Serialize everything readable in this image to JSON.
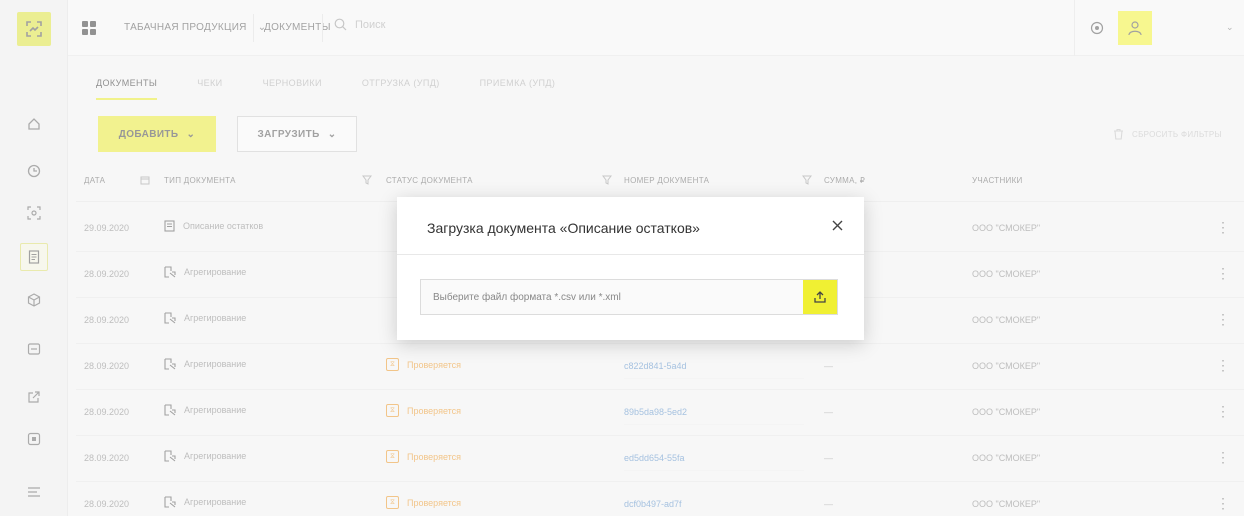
{
  "topbar": {
    "product": "ТАБАЧНАЯ ПРОДУКЦИЯ",
    "documents": "ДОКУМЕНТЫ",
    "search_placeholder": "Поиск"
  },
  "tabs": [
    {
      "label": "ДОКУМЕНТЫ",
      "active": true
    },
    {
      "label": "ЧЕКИ"
    },
    {
      "label": "ЧЕРНОВИКИ"
    },
    {
      "label": "ОТГРУЗКА (УПД)"
    },
    {
      "label": "ПРИЕМКА (УПД)"
    }
  ],
  "actions": {
    "add": "ДОБАВИТЬ",
    "load": "ЗАГРУЗИТЬ",
    "reset_filters": "СБРОСИТЬ ФИЛЬТРЫ"
  },
  "table": {
    "headers": {
      "date": "ДАТА",
      "type": "ТИП ДОКУМЕНТА",
      "status": "СТАТУС ДОКУМЕНТА",
      "number": "НОМЕР ДОКУМЕНТА",
      "sum": "СУММА, ₽",
      "participants": "УЧАСТНИКИ"
    },
    "rows": [
      {
        "date": "29.09.2020",
        "type": "Описание остатков",
        "status": "",
        "number": "",
        "sum": "",
        "participants": "ООО \"СМОКЕР\""
      },
      {
        "date": "28.09.2020",
        "type": "Агрегирование",
        "status": "",
        "number": "",
        "sum": "",
        "participants": "ООО \"СМОКЕР\""
      },
      {
        "date": "28.09.2020",
        "type": "Агрегирование",
        "status": "",
        "number": "",
        "sum": "",
        "participants": "ООО \"СМОКЕР\""
      },
      {
        "date": "28.09.2020",
        "type": "Агрегирование",
        "status": "Проверяется",
        "number": "c822d841-5a4d",
        "sum": "—",
        "participants": "ООО \"СМОКЕР\""
      },
      {
        "date": "28.09.2020",
        "type": "Агрегирование",
        "status": "Проверяется",
        "number": "89b5da98-5ed2",
        "sum": "—",
        "participants": "ООО \"СМОКЕР\""
      },
      {
        "date": "28.09.2020",
        "type": "Агрегирование",
        "status": "Проверяется",
        "number": "ed5dd654-55fa",
        "sum": "—",
        "participants": "ООО \"СМОКЕР\""
      },
      {
        "date": "28.09.2020",
        "type": "Агрегирование",
        "status": "Проверяется",
        "number": "dcf0b497-ad7f",
        "sum": "—",
        "participants": "ООО \"СМОКЕР\""
      }
    ]
  },
  "modal": {
    "title": "Загрузка документа «Описание остатков»",
    "file_placeholder": "Выберите файл формата *.csv или *.xml"
  },
  "colors": {
    "accent": "#e8e833",
    "status": "#e89528",
    "link": "#5b8fc6"
  }
}
